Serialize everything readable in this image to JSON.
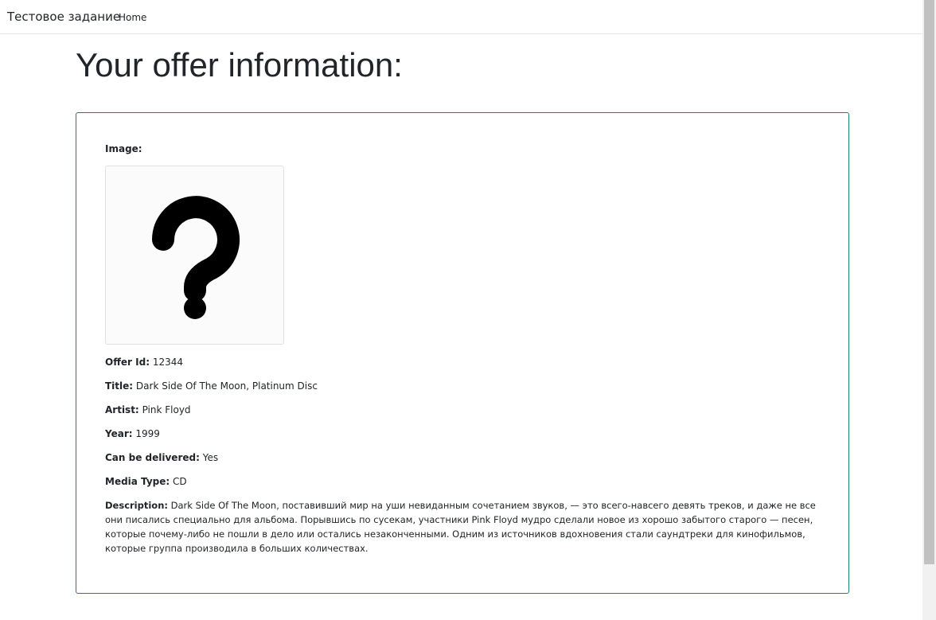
{
  "navbar": {
    "brand": "Тестовое задание",
    "home_label": "Home"
  },
  "page": {
    "title": "Your offer information:"
  },
  "offer": {
    "image_label": "Image:",
    "image_icon": "question-mark-placeholder-icon",
    "offer_id_label": "Offer Id:",
    "offer_id": "12344",
    "title_label": "Title:",
    "title": "Dark Side Of The Moon, Platinum Disc",
    "artist_label": "Artist:",
    "artist": "Pink Floyd",
    "year_label": "Year:",
    "year": "1999",
    "delivered_label": "Can be delivered:",
    "delivered": "Yes",
    "media_type_label": "Media Type:",
    "media_type": "CD",
    "description_label": "Description:",
    "description": "Dark Side Of The Moon, поставивший мир на уши невиданным сочетанием звуков, — это всего-навсего девять треков, и даже не все они писались специально для альбома. Порывшись по сусекам, участники Pink Floyd мудро сделали новое из хорошо забытого старого — песен, которые почему-либо не пошли в дело или остались незаконченными. Одним из источников вдохновения стали саундтреки для кинофильмов, которые группа производила в больших количествах."
  },
  "colors": {
    "card_border": "#17807f",
    "text": "#212529"
  }
}
